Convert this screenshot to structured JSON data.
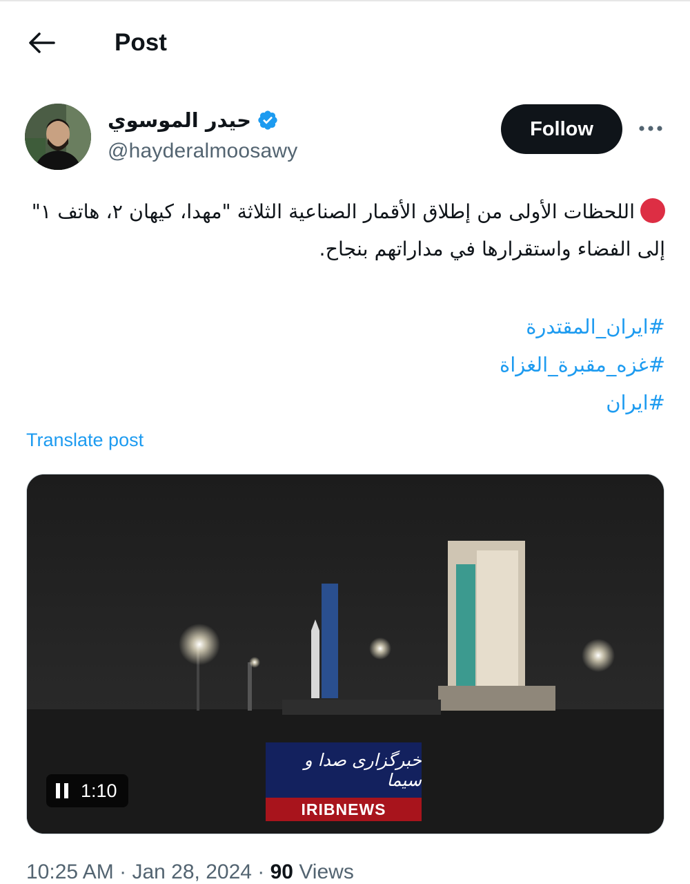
{
  "header": {
    "back_icon": "arrow-left-icon",
    "title": "Post"
  },
  "author": {
    "display_name": "حيدر الموسوي",
    "verified": true,
    "verified_color": "#1d9bf0",
    "handle": "@hayderalmoosawy",
    "follow_label": "Follow",
    "more_icon": "more-horizontal-icon"
  },
  "post": {
    "bullet_icon": "red-circle-icon",
    "text": "اللحظات الأولى من إطلاق الأقمار الصناعية الثلاثة \"مهدا، كيهان ٢، هاتف ١\" إلى الفضاء واستقرارها في مداراتهم بنجاح.",
    "hashtags": [
      "#ايران_المقتدرة",
      "#غزه_مقبرة_الغزاة",
      "#ايران"
    ],
    "translate_label": "Translate post"
  },
  "video": {
    "duration": "1:10",
    "pause_icon": "pause-icon",
    "watermark_title": "خبرگزاری صدا و سیما",
    "watermark_label": "IRIBNEWS"
  },
  "meta": {
    "time": "10:25 AM",
    "separator": "·",
    "date": "Jan 28, 2024",
    "views_count": "90",
    "views_label": "Views"
  },
  "colors": {
    "accent": "#1d9bf0",
    "text": "#0f1419",
    "secondary": "#536471",
    "follow_bg": "#0f1419",
    "bullet_red": "#dd2e44"
  }
}
